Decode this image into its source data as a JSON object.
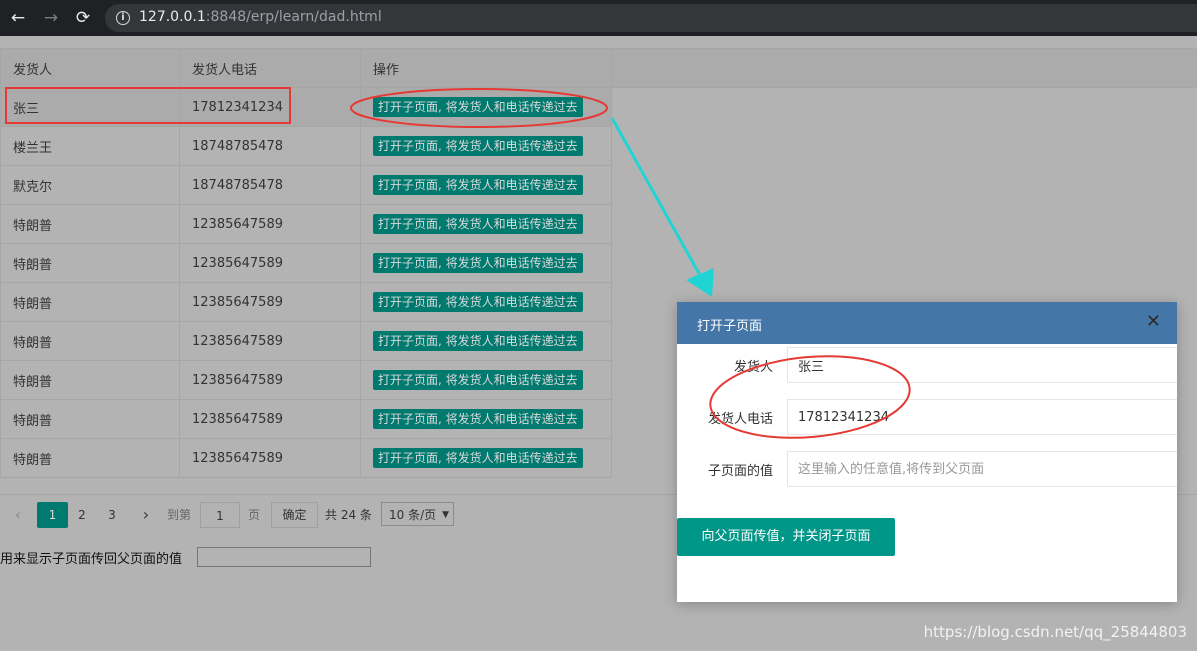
{
  "browser": {
    "url_host": "127.0.0.1",
    "url_rest": ":8848/erp/learn/dad.html"
  },
  "table": {
    "headers": [
      "发货人",
      "发货人电话",
      "操作"
    ],
    "action_label": "打开子页面, 将发货人和电话传递过去",
    "rows": [
      {
        "name": "张三",
        "phone": "17812341234"
      },
      {
        "name": "楼兰王",
        "phone": "18748785478"
      },
      {
        "name": "默克尔",
        "phone": "18748785478"
      },
      {
        "name": "特朗普",
        "phone": "12385647589"
      },
      {
        "name": "特朗普",
        "phone": "12385647589"
      },
      {
        "name": "特朗普",
        "phone": "12385647589"
      },
      {
        "name": "特朗普",
        "phone": "12385647589"
      },
      {
        "name": "特朗普",
        "phone": "12385647589"
      },
      {
        "name": "特朗普",
        "phone": "12385647589"
      },
      {
        "name": "特朗普",
        "phone": "12385647589"
      }
    ]
  },
  "pager": {
    "prev": "‹",
    "pages": [
      "1",
      "2",
      "3"
    ],
    "current": "1",
    "next": "›",
    "goto_label": "到第",
    "goto_value": "1",
    "page_suffix": "页",
    "confirm": "确定",
    "total": "共 24 条",
    "page_size": "10 条/页"
  },
  "parent": {
    "label": "用来显示子页面传回父页面的值",
    "value": ""
  },
  "modal": {
    "title": "打开子页面",
    "close": "✕",
    "fields": [
      {
        "label": "发货人",
        "value": "张三",
        "placeholder": ""
      },
      {
        "label": "发货人电话",
        "value": "17812341234",
        "placeholder": ""
      },
      {
        "label": "子页面的值",
        "value": "",
        "placeholder": "这里输入的任意值,将传到父页面"
      }
    ],
    "submit": "向父页面传值，并关闭子页面"
  },
  "annotation_colors": {
    "highlight": "#e53935",
    "arrow": "#21d4d4"
  },
  "watermark": "https://blog.csdn.net/qq_25844803"
}
